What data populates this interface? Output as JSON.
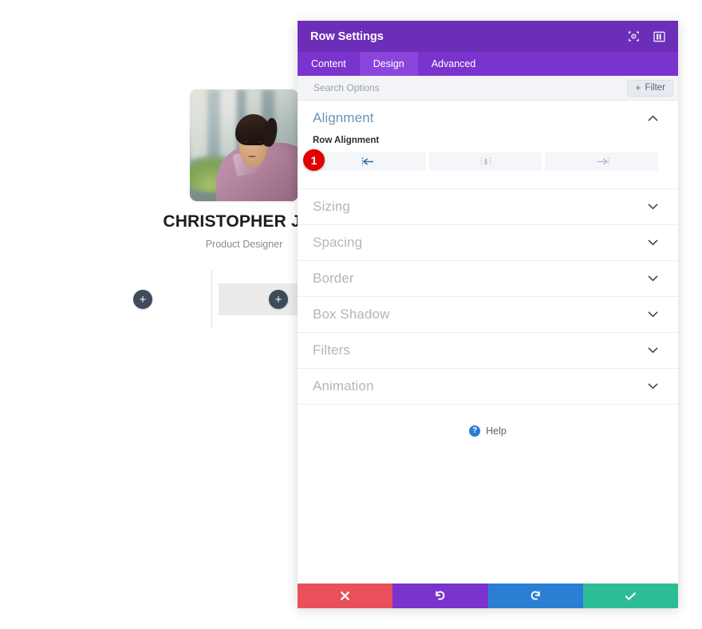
{
  "canvas": {
    "person": {
      "name": "CHRISTOPHER JOE",
      "role": "Product Designer",
      "photo_alt": "portrait-photo"
    },
    "add_row_label": "+",
    "add_module_label": "+"
  },
  "modal": {
    "title": "Row Settings",
    "header_icons": [
      {
        "name": "focus-target-icon",
        "label": ""
      },
      {
        "name": "layout-panel-icon",
        "label": ""
      }
    ],
    "tabs": [
      {
        "label": "Content",
        "active": false
      },
      {
        "label": "Design",
        "active": true
      },
      {
        "label": "Advanced",
        "active": false
      }
    ],
    "search": {
      "placeholder": "Search Options",
      "value": ""
    },
    "filter": {
      "label": "Filter",
      "plus": "+"
    },
    "open_section": {
      "title": "Alignment",
      "field_label": "Row Alignment",
      "options": [
        {
          "name": "align-left",
          "active": true
        },
        {
          "name": "align-center",
          "active": false
        },
        {
          "name": "align-right",
          "active": false
        }
      ]
    },
    "sections": [
      {
        "title": "Sizing"
      },
      {
        "title": "Spacing"
      },
      {
        "title": "Border"
      },
      {
        "title": "Box Shadow"
      },
      {
        "title": "Filters"
      },
      {
        "title": "Animation"
      }
    ],
    "help": {
      "label": "Help",
      "icon_char": "?"
    },
    "footer": [
      {
        "name": "cancel",
        "glyph": "✖",
        "color": "#e8505b"
      },
      {
        "name": "undo",
        "glyph": "↺",
        "color": "#7a33cd"
      },
      {
        "name": "redo",
        "glyph": "↻",
        "color": "#2a7fd4"
      },
      {
        "name": "save",
        "glyph": "✔",
        "color": "#2dbd96"
      }
    ]
  },
  "annotation": {
    "step_number": "1"
  },
  "colors": {
    "header_purple": "#6c2eb9",
    "tabbar_purple": "#7a33cd",
    "tab_active_purple": "#8b45dd",
    "section_open_title": "#6e93b5",
    "section_title": "#b3b5ba",
    "badge_red": "#e00000",
    "accent_blue": "#2b7cd3"
  }
}
